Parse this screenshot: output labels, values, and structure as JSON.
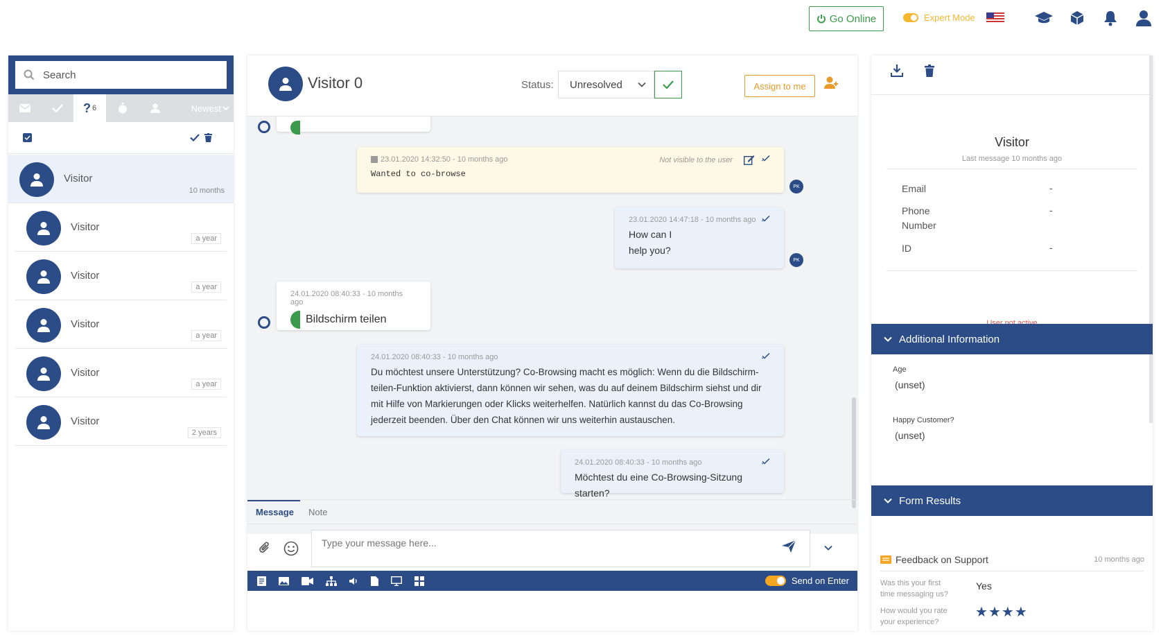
{
  "topbar": {
    "go_online": "Go Online",
    "expert_mode": "Expert Mode"
  },
  "left": {
    "search_placeholder": "Search",
    "filter_count": "6",
    "sort_label": "Newest",
    "visitors": [
      {
        "name": "Visitor",
        "time": "10 months"
      },
      {
        "name": "Visitor",
        "time": "a year"
      },
      {
        "name": "Visitor",
        "time": "a year"
      },
      {
        "name": "Visitor",
        "time": "a year"
      },
      {
        "name": "Visitor",
        "time": "a year"
      },
      {
        "name": "Visitor",
        "time": "2 years"
      }
    ]
  },
  "chat": {
    "title": "Visitor 0",
    "status_label": "Status:",
    "status_value": "Unresolved",
    "assign": "Assign to me",
    "messages": [
      {
        "meta": "23.01.2020 14:32:50 - 10 months ago",
        "note_flag": "Not visible to the user",
        "text": "Wanted to co-browse",
        "avatar": "PK"
      },
      {
        "meta": "23.01.2020 14:47:18 - 10 months ago",
        "text1": "How can I",
        "text2": "help you?",
        "avatar": "PK"
      },
      {
        "meta": "24.01.2020 08:40:33 - 10 months ago",
        "text": "Bildschirm teilen"
      },
      {
        "meta": "24.01.2020 08:40:33 - 10 months ago",
        "l1": "Du möchtest unsere Unterstützung? Co-Browsing macht es möglich: Wenn du die Bildschirm-",
        "l2": "teilen-Funktion aktivierst, dann können wir sehen, was du auf deinem Bildschirm siehst und dir",
        "l3": "mit Hilfe von Markierungen oder Klicks weiterhelfen. Natürlich kannst du das Co-Browsing",
        "l4": "jederzeit beenden. Über den Chat können wir uns weiterhin austauschen."
      },
      {
        "meta": "24.01.2020 08:40:33 - 10 months ago",
        "text": "Möchtest du eine Co-Browsing-Sitzung starten?"
      }
    ],
    "tab_message": "Message",
    "tab_note": "Note",
    "compose_placeholder": "Type your message here...",
    "send_on_enter": "Send on Enter"
  },
  "right": {
    "name": "Visitor",
    "last_message": "Last message 10 months ago",
    "fields": [
      {
        "label": "Email",
        "value": "-"
      },
      {
        "label1": "Phone",
        "label2": "Number",
        "value": "-"
      },
      {
        "label": "ID",
        "value": "-"
      }
    ],
    "inactive": "User not active",
    "additional": "Additional Information",
    "age_label": "Age",
    "age_value": "(unset)",
    "happy_label": "Happy Customer?",
    "happy_value": "(unset)",
    "form_results": "Form Results",
    "form_title": "Feedback on Support",
    "form_time": "10 months ago",
    "q1a": "Was this your first",
    "q1b": "time messaging us?",
    "a1": "Yes",
    "q2a": "How would you rate",
    "q2b": "your experience?",
    "rating": 4
  },
  "colors": {
    "primary": "#2b4c86",
    "success": "#3c9a4c",
    "accent": "#f5a623",
    "danger": "#d9534f"
  }
}
